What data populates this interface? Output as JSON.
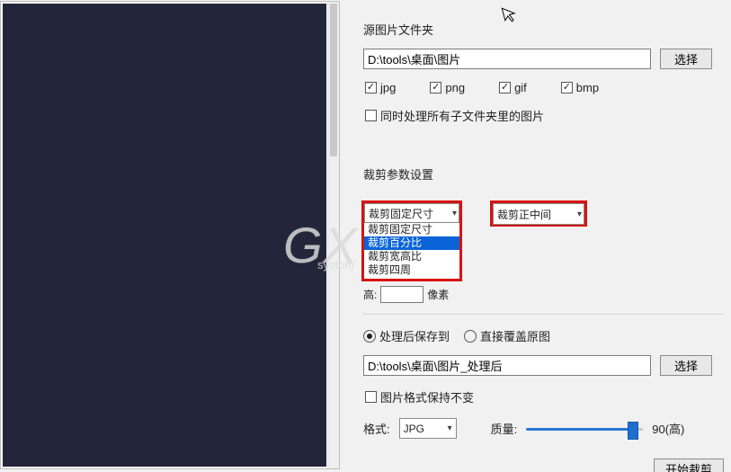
{
  "watermark": {
    "main": "GX",
    "sub": "system"
  },
  "source": {
    "title": "源图片文件夹",
    "path": "D:\\tools\\桌面\\图片",
    "browse": "选择",
    "formats": {
      "jpg": {
        "label": "jpg",
        "checked": true
      },
      "png": {
        "label": "png",
        "checked": true
      },
      "gif": {
        "label": "gif",
        "checked": true
      },
      "bmp": {
        "label": "bmp",
        "checked": true
      }
    },
    "recurse": {
      "label": "同时处理所有子文件夹里的图片",
      "checked": false
    }
  },
  "crop": {
    "title": "裁剪参数设置",
    "mode": {
      "selected": "裁剪固定尺寸",
      "options": [
        "裁剪固定尺寸",
        "裁剪百分比",
        "裁剪宽高比",
        "裁剪四周"
      ]
    },
    "anchor": {
      "selected": "裁剪正中间"
    },
    "height_label": "高:",
    "height_value": "",
    "unit": "像素"
  },
  "output": {
    "save_mode": {
      "save_to": {
        "label": "处理后保存到",
        "checked": true
      },
      "overwrite": {
        "label": "直接覆盖原图",
        "checked": false
      }
    },
    "path": "D:\\tools\\桌面\\图片_处理后",
    "browse": "选择",
    "keep_fmt": {
      "label": "图片格式保持不变",
      "checked": false
    },
    "format_label": "格式:",
    "format_value": "JPG",
    "quality_label": "质量:",
    "quality_value": "90(高)",
    "slider_percent": 90,
    "run": "开始裁剪"
  }
}
